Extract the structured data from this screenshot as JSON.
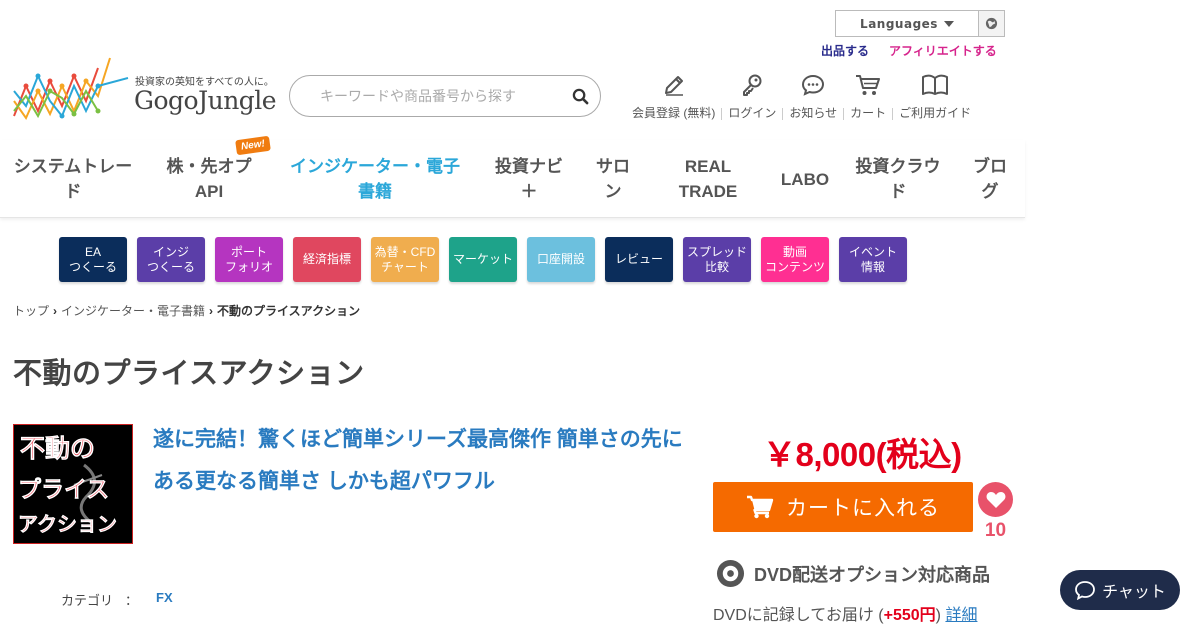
{
  "header": {
    "language_label": "Languages",
    "sell_link": "出品する",
    "affiliate_link": "アフィリエイトする",
    "logo_tagline": "投資家の英知をすべての人に。",
    "logo_brand": "GogoJungle",
    "search_placeholder": "キーワードや商品番号から探す",
    "icons": [
      {
        "label": "会員登録 (無料)",
        "icon": "pencil-icon"
      },
      {
        "label": "ログイン",
        "icon": "key-icon"
      },
      {
        "label": "お知らせ",
        "icon": "chat-bubble-icon"
      },
      {
        "label": "カート",
        "icon": "cart-icon"
      },
      {
        "label": "ご利用ガイド",
        "icon": "book-icon"
      }
    ]
  },
  "nav": {
    "items": [
      {
        "label": "システムトレード"
      },
      {
        "label": "株・先オプ API",
        "badge": "New!"
      },
      {
        "label": "インジケーター・電子書籍"
      },
      {
        "label": "投資ナビ＋"
      },
      {
        "label": "サロン"
      },
      {
        "label": "REAL TRADE"
      },
      {
        "label": "LABO"
      },
      {
        "label": "投資クラウド"
      },
      {
        "label": "ブログ"
      }
    ]
  },
  "categories": [
    {
      "label": "EA\nつくーる",
      "color": "#0b2d5b"
    },
    {
      "label": "インジ\nつくーる",
      "color": "#5b3ea8"
    },
    {
      "label": "ポート\nフォリオ",
      "color": "#b535c0"
    },
    {
      "label": "経済指標",
      "color": "#e0475f"
    },
    {
      "label": "為替・CFD\nチャート",
      "color": "#f0ad4e"
    },
    {
      "label": "マーケット",
      "color": "#1ea38a"
    },
    {
      "label": "口座開設",
      "color": "#6cc0de"
    },
    {
      "label": "レビュー",
      "color": "#0b2d5b"
    },
    {
      "label": "スプレッド\n比較",
      "color": "#5b3ea8"
    },
    {
      "label": "動画\nコンテンツ",
      "color": "#ff2f92"
    },
    {
      "label": "イベント\n情報",
      "color": "#5b3ea8"
    }
  ],
  "breadcrumb": {
    "home": "トップ",
    "section": "インジケーター・電子書籍",
    "current": "不動のプライスアクション"
  },
  "product": {
    "title": "不動のプライスアクション",
    "headline": "遂に完結！驚くほど簡単シリーズ最高傑作 簡単さの先にある更なる簡単さ しかも超パワフル",
    "thumb_text": [
      "不動の",
      "プライス",
      "アクション"
    ],
    "category_label": "カテゴリ",
    "category_colon": "：",
    "category_value": "FX",
    "price": "￥8,000(税込)",
    "cart_label": "カートに入れる",
    "favorite_count": "10",
    "dvd_label": "DVD配送オプション対応商品",
    "dvd_note_prefix": "DVDに記録してお届け (",
    "dvd_note_plus": "+550円",
    "dvd_note_suffix": ") ",
    "dvd_detail_link": "詳細"
  },
  "chat": {
    "label": "チャット"
  },
  "colors": {
    "accent_blue": "#2ba7d9",
    "price_red": "#e3001b",
    "cart_orange": "#f56a00",
    "favorite_pink": "#e8526a"
  }
}
